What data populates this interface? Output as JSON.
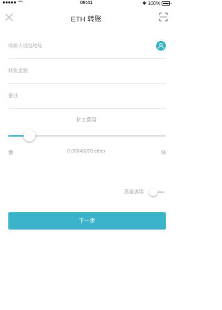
{
  "status_bar": {
    "time": "09:41",
    "battery": "100%"
  },
  "nav": {
    "title": "ETH 转账",
    "close_icon": "close-icon",
    "scan_icon": "scan-icon"
  },
  "form": {
    "address_placeholder": "收款人钱包地址",
    "amount_placeholder": "转账金额",
    "memo_placeholder": "备注",
    "contact_icon": "contact-icon"
  },
  "fee": {
    "label": "矿工费用",
    "slow_label": "慢",
    "fast_label": "快",
    "value": "0.00046200 ether",
    "slider_level": 0.13
  },
  "advanced": {
    "label": "高级选项",
    "enabled": false
  },
  "next_button": "下一步",
  "colors": {
    "accent": "#3bb3c8",
    "divider": "#eaeaea",
    "placeholder": "#b4b4b4"
  }
}
